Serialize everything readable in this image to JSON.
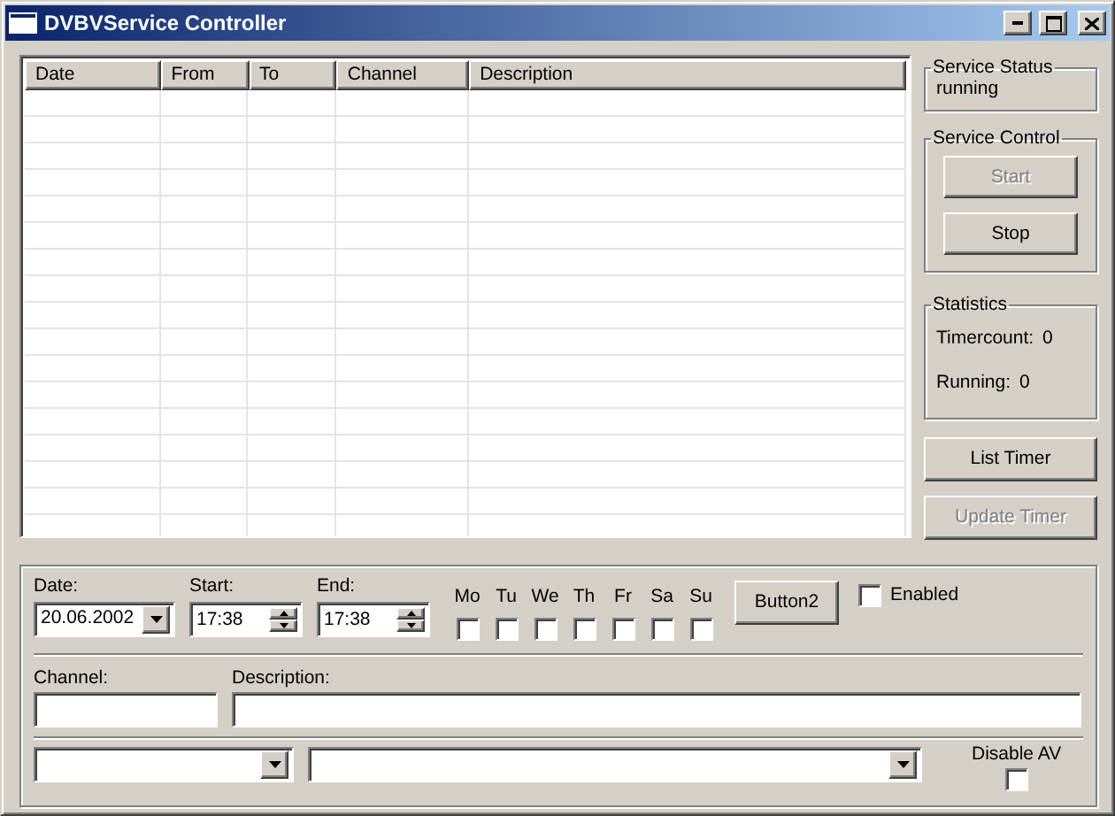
{
  "window": {
    "title": "DVBVService Controller"
  },
  "timer_table": {
    "columns": [
      "Date",
      "From",
      "To",
      "Channel",
      "Description"
    ]
  },
  "service_status": {
    "title": "Service Status",
    "value": "running"
  },
  "service_control": {
    "title": "Service Control",
    "buttons": [
      {
        "label": "Start",
        "disabled": true
      },
      {
        "label": "Stop",
        "disabled": false
      }
    ]
  },
  "statistics": {
    "title": "Statistics",
    "rows": [
      {
        "label": "Timercount:",
        "value": "0"
      },
      {
        "label": "Running:",
        "value": "0"
      }
    ]
  },
  "side_buttons": [
    {
      "label": "List Timer",
      "disabled": false
    },
    {
      "label": "Update Timer",
      "disabled": true
    }
  ],
  "editor": {
    "date": {
      "label": "Date:",
      "value": "20.06.2002"
    },
    "start": {
      "label": "Start:",
      "value": "17:38"
    },
    "end": {
      "label": "End:",
      "value": "17:38"
    },
    "days": [
      {
        "label": "Mo",
        "checked": false
      },
      {
        "label": "Tu",
        "checked": false
      },
      {
        "label": "We",
        "checked": false
      },
      {
        "label": "Th",
        "checked": false
      },
      {
        "label": "Fr",
        "checked": false
      },
      {
        "label": "Sa",
        "checked": false
      },
      {
        "label": "Su",
        "checked": false
      }
    ],
    "button": "Button2",
    "enabled": {
      "label": "Enabled",
      "checked": false
    },
    "channel": {
      "label": "Channel:"
    },
    "description": {
      "label": "Description:"
    },
    "disable_av": {
      "label": "Disable AV",
      "checked": false
    }
  }
}
